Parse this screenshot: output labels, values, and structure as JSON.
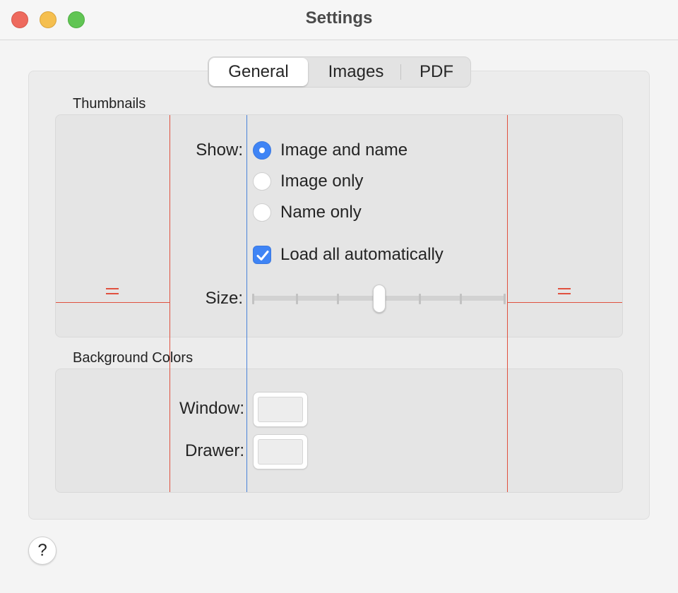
{
  "window": {
    "title": "Settings"
  },
  "tabs": [
    {
      "label": "General",
      "selected": true
    },
    {
      "label": "Images",
      "selected": false
    },
    {
      "label": "PDF",
      "selected": false
    }
  ],
  "thumbnails": {
    "section_title": "Thumbnails",
    "show_label": "Show:",
    "show_options": [
      {
        "label": "Image and name",
        "selected": true
      },
      {
        "label": "Image only",
        "selected": false
      },
      {
        "label": "Name only",
        "selected": false
      }
    ],
    "load_all": {
      "label": "Load all automatically",
      "checked": true
    },
    "size_label": "Size:",
    "size_slider": {
      "tick_count": 7,
      "value_fraction": 0.5
    }
  },
  "background_colors": {
    "section_title": "Background Colors",
    "window_label": "Window:",
    "window_color": "#ededed",
    "drawer_label": "Drawer:",
    "drawer_color": "#ededed"
  },
  "help_label": "?",
  "colors": {
    "accent": "#3f84f5",
    "guide_red": "#e0513f",
    "guide_blue": "#4a82d9",
    "close": "#ee6a5e",
    "minimize": "#f5bf4f",
    "zoom": "#61c554"
  }
}
